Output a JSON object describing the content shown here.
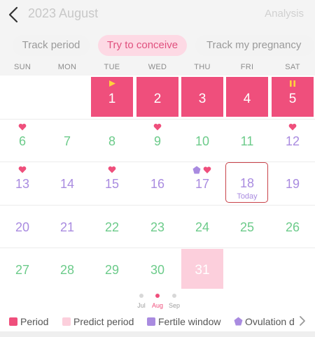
{
  "header": {
    "title": "2023 August",
    "right": "Analysis"
  },
  "tabs": [
    "Track period",
    "Try to conceive",
    "Track my pregnancy"
  ],
  "weekdays": [
    "SUN",
    "MON",
    "TUE",
    "WED",
    "THU",
    "FRI",
    "SAT"
  ],
  "calendar": {
    "today_label": "Today",
    "days": [
      {
        "d": "1",
        "type": "period",
        "mark": "flag"
      },
      {
        "d": "2",
        "type": "period"
      },
      {
        "d": "3",
        "type": "period"
      },
      {
        "d": "4",
        "type": "period"
      },
      {
        "d": "5",
        "type": "period",
        "mark": "pause"
      },
      {
        "d": "6",
        "type": "green",
        "mark": "heart"
      },
      {
        "d": "7",
        "type": "green"
      },
      {
        "d": "8",
        "type": "green"
      },
      {
        "d": "9",
        "type": "green",
        "mark": "heart"
      },
      {
        "d": "10",
        "type": "green"
      },
      {
        "d": "11",
        "type": "green"
      },
      {
        "d": "12",
        "type": "purple",
        "mark": "heart"
      },
      {
        "d": "13",
        "type": "purple",
        "mark": "heart"
      },
      {
        "d": "14",
        "type": "purple"
      },
      {
        "d": "15",
        "type": "purple",
        "mark": "heart"
      },
      {
        "d": "16",
        "type": "purple"
      },
      {
        "d": "17",
        "type": "purple",
        "mark": "ovulation-heart"
      },
      {
        "d": "18",
        "type": "purple",
        "today": true
      },
      {
        "d": "19",
        "type": "purple"
      },
      {
        "d": "20",
        "type": "purple"
      },
      {
        "d": "21",
        "type": "purple"
      },
      {
        "d": "22",
        "type": "green"
      },
      {
        "d": "23",
        "type": "green"
      },
      {
        "d": "24",
        "type": "green"
      },
      {
        "d": "25",
        "type": "green"
      },
      {
        "d": "26",
        "type": "green"
      },
      {
        "d": "27",
        "type": "green"
      },
      {
        "d": "28",
        "type": "green"
      },
      {
        "d": "29",
        "type": "green"
      },
      {
        "d": "30",
        "type": "green"
      },
      {
        "d": "31",
        "type": "predict"
      }
    ]
  },
  "months": [
    "Jul",
    "Aug",
    "Sep"
  ],
  "legend": [
    "Period",
    "Predict period",
    "Fertile window",
    "Ovulation d"
  ],
  "colors": {
    "period": "#ef4f7c",
    "predict": "#fccfdc",
    "fertile": "#a98be0",
    "green": "#6ccb8a",
    "today_border": "#c9434a"
  }
}
